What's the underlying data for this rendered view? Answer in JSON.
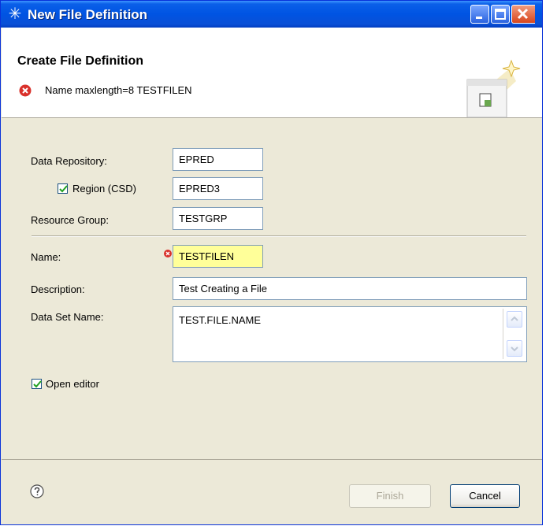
{
  "window": {
    "title": "New File Definition",
    "app_icon": "gear-icon"
  },
  "header": {
    "title": "Create File Definition",
    "error_message": "Name maxlength=8 TESTFILEN",
    "error_icon": "error-icon",
    "banner_icon": "file-definition-wizard-icon"
  },
  "form": {
    "data_repository_label": "Data Repository:",
    "data_repository_value": "EPRED",
    "region_label": "Region (CSD)",
    "region_checked": true,
    "region_value": "EPRED3",
    "resource_group_label": "Resource Group:",
    "resource_group_value": "TESTGRP",
    "name_label": "Name:",
    "name_value": "TESTFILEN",
    "description_label": "Description:",
    "description_value": "Test Creating a File",
    "data_set_name_label": "Data Set Name:",
    "data_set_name_value": "TEST.FILE.NAME",
    "open_editor_label": "Open editor",
    "open_editor_checked": true
  },
  "footer": {
    "help_icon": "help-icon",
    "finish_label": "Finish",
    "finish_enabled": false,
    "cancel_label": "Cancel"
  },
  "colors": {
    "title_bar": "#0054e3",
    "dialog_bg": "#ece9d8",
    "error_field_bg": "#ffff99",
    "error_icon": "#d9312b"
  }
}
